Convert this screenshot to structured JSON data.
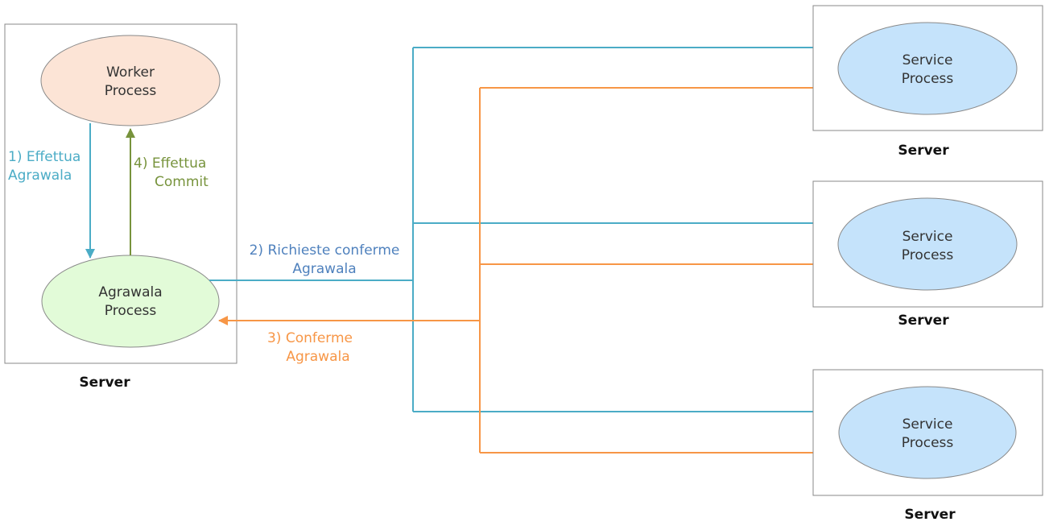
{
  "colors": {
    "request": "#4bacc6",
    "response": "#f79646",
    "commit": "#77933c",
    "worker_fill": "#fce4d6",
    "agrawala_fill": "#e2fbd8",
    "service_fill": "#c5e3fb",
    "box_border": "#888888",
    "request_label": "#4f81bd"
  },
  "main_server": {
    "label": "Server",
    "worker": {
      "line1": "Worker",
      "line2": "Process"
    },
    "agrawala": {
      "line1": "Agrawala",
      "line2": "Process"
    }
  },
  "remote_servers": [
    {
      "label": "Server",
      "line1": "Service",
      "line2": "Process"
    },
    {
      "label": "Server",
      "line1": "Service",
      "line2": "Process"
    },
    {
      "label": "Server",
      "line1": "Service",
      "line2": "Process"
    }
  ],
  "edges": {
    "step1": {
      "line1": "1) Effettua",
      "line2": "Agrawala"
    },
    "step2": {
      "line1": "2) Richieste conferme",
      "line2": "Agrawala"
    },
    "step3": {
      "line1": "3) Conferme",
      "line2": "Agrawala"
    },
    "step4": {
      "line1": "4) Effettua",
      "line2": "Commit"
    }
  }
}
